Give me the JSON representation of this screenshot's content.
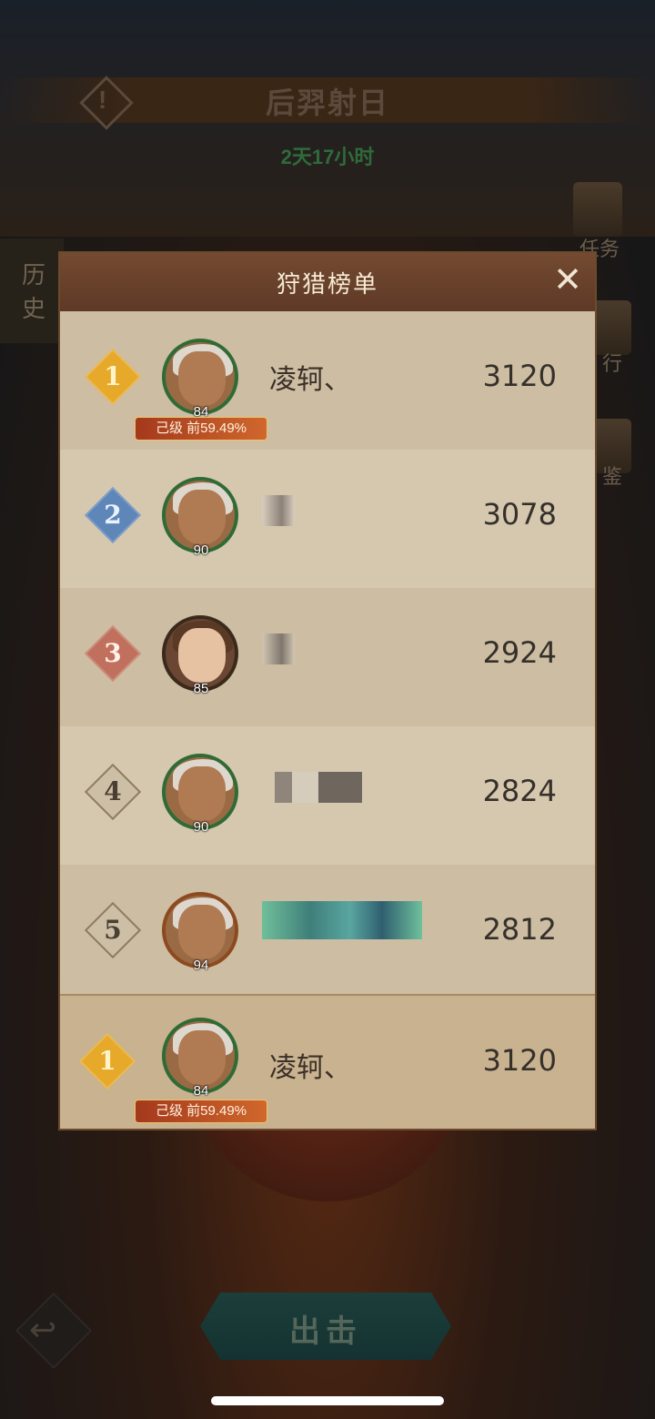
{
  "background": {
    "event_title": "后羿射日",
    "timer": "2天17小时",
    "history_label": "历史",
    "side_buttons": [
      {
        "label": "任务",
        "icon": "scroll-icon"
      },
      {
        "label": "行",
        "icon": "ranking-icon"
      },
      {
        "label": "鉴",
        "icon": "book-icon"
      }
    ],
    "attack_button_label": "出击"
  },
  "modal": {
    "title": "狩猎榜单",
    "close_icon": "close-icon",
    "rows": [
      {
        "rank": "1",
        "name": "凌轲、",
        "score": "3120",
        "level": "84",
        "tag": "己级  前59.49%",
        "badge_color": "#e6a92a"
      },
      {
        "rank": "2",
        "name": "",
        "score": "3078",
        "level": "90",
        "tag": "",
        "badge_color": "#5e86b8"
      },
      {
        "rank": "3",
        "name": "",
        "score": "2924",
        "level": "85",
        "tag": "",
        "badge_color": "#c0705c"
      },
      {
        "rank": "4",
        "name": "",
        "score": "2824",
        "level": "90",
        "tag": "",
        "badge_color": "#c9b89a"
      },
      {
        "rank": "5",
        "name": "",
        "score": "2812",
        "level": "94",
        "tag": "",
        "badge_color": "#c9b89a"
      }
    ],
    "self_row": {
      "rank": "1",
      "name": "凌轲、",
      "score": "3120",
      "level": "84",
      "tag": "己级  前59.49%",
      "badge_color": "#e6a92a"
    }
  }
}
